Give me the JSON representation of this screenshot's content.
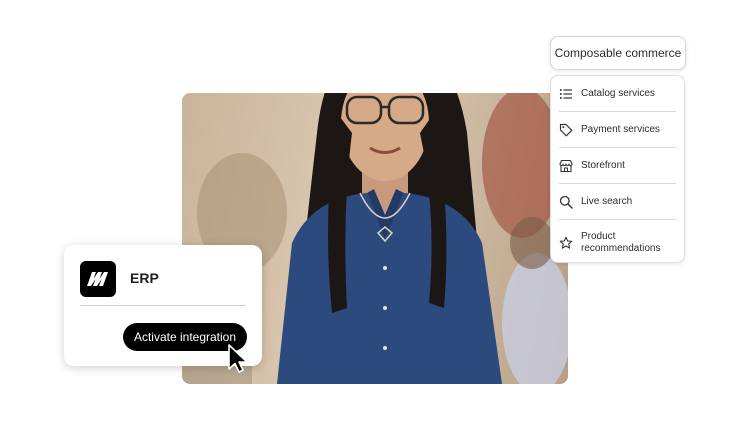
{
  "composable": {
    "title": "Composable commerce",
    "items": [
      {
        "label": "Catalog services",
        "icon": "list-icon"
      },
      {
        "label": "Payment services",
        "icon": "tag-icon"
      },
      {
        "label": "Storefront",
        "icon": "storefront-icon"
      },
      {
        "label": "Live search",
        "icon": "search-icon"
      },
      {
        "label": "Product recommendations",
        "icon": "star-icon"
      }
    ]
  },
  "erp": {
    "title": "ERP",
    "logo_icon": "magento-logo-icon",
    "button_label": "Activate integration"
  },
  "cursor_icon": "pointer-cursor-icon"
}
